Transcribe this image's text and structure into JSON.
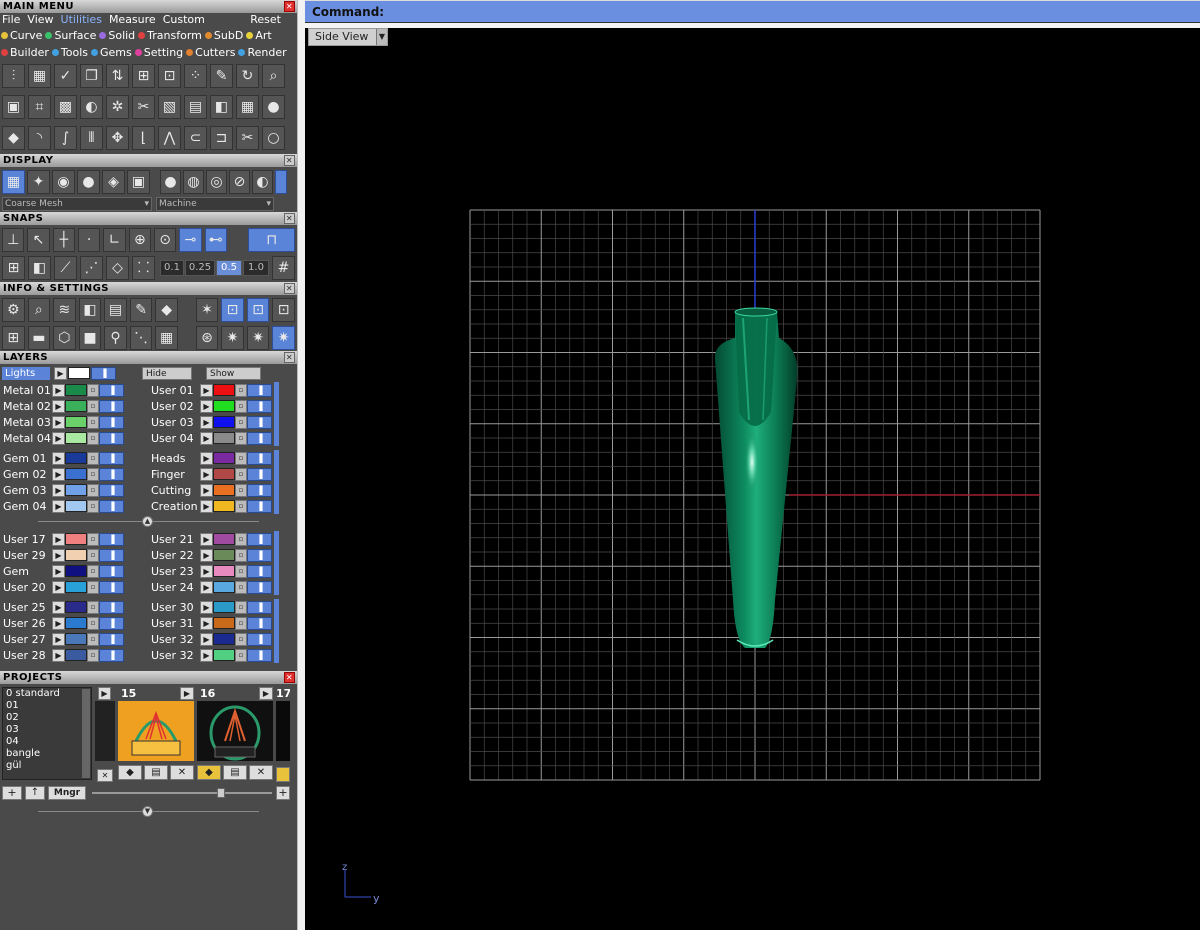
{
  "main_menu": {
    "title": "MAIN MENU",
    "menu": [
      "File",
      "View",
      "Utilities",
      "Measure",
      "Custom"
    ],
    "reset": "Reset",
    "categories_row1": [
      {
        "label": "Curve",
        "color": "#e8c23a"
      },
      {
        "label": "Surface",
        "color": "#3ac26a"
      },
      {
        "label": "Solid",
        "color": "#9a6ae0"
      },
      {
        "label": "Transform",
        "color": "#e04040"
      },
      {
        "label": "SubD",
        "color": "#e08a30"
      },
      {
        "label": "Art",
        "color": "#e8d23a"
      }
    ],
    "categories_row2": [
      {
        "label": "Builder",
        "color": "#e04040"
      },
      {
        "label": "Tools",
        "color": "#40a0e0"
      },
      {
        "label": "Gems",
        "color": "#40a0e0"
      },
      {
        "label": "Setting",
        "color": "#e040a0"
      },
      {
        "label": "Cutters",
        "color": "#e08030"
      },
      {
        "label": "Render",
        "color": "#40a0e0"
      }
    ]
  },
  "display": {
    "title": "DISPLAY",
    "mesh_select": "Coarse Mesh",
    "material_select": "Machine"
  },
  "snaps": {
    "title": "SNAPS",
    "values": [
      "0.1",
      "0.25",
      "0.5",
      "1.0"
    ]
  },
  "info": {
    "title": "INFO & SETTINGS"
  },
  "layers": {
    "title": "LAYERS",
    "lights": "Lights",
    "hide": "Hide",
    "show": "Show",
    "group1_left": [
      {
        "name": "Metal 01",
        "color": "#1a8a4a"
      },
      {
        "name": "Metal 02",
        "color": "#3ab05a"
      },
      {
        "name": "Metal 03",
        "color": "#6ad06a"
      },
      {
        "name": "Metal 04",
        "color": "#a8e8a0"
      }
    ],
    "group1_right": [
      {
        "name": "User 01",
        "color": "#ee1010"
      },
      {
        "name": "User 02",
        "color": "#20dd20"
      },
      {
        "name": "User 03",
        "color": "#1010ee"
      },
      {
        "name": "User 04",
        "color": "#8a8a8a"
      }
    ],
    "group2_left": [
      {
        "name": "Gem 01",
        "color": "#1a3a9a"
      },
      {
        "name": "Gem 02",
        "color": "#3a70d0"
      },
      {
        "name": "Gem 03",
        "color": "#70a0e8"
      },
      {
        "name": "Gem 04",
        "color": "#a0c8f0"
      }
    ],
    "group2_right": [
      {
        "name": "Heads",
        "color": "#7a2aa0"
      },
      {
        "name": "Finger",
        "color": "#b04848"
      },
      {
        "name": "Cutting",
        "color": "#e87020"
      },
      {
        "name": "Creation",
        "color": "#f0b820"
      }
    ],
    "group3_left": [
      {
        "name": "User 17",
        "color": "#f08080"
      },
      {
        "name": "User 29",
        "color": "#f0d0b0"
      },
      {
        "name": "Gem",
        "color": "#101080"
      },
      {
        "name": "User 20",
        "color": "#2aa0d8"
      }
    ],
    "group3_right": [
      {
        "name": "User 21",
        "color": "#a04aa0"
      },
      {
        "name": "User 22",
        "color": "#6a8a5a"
      },
      {
        "name": "User 23",
        "color": "#e88ac0"
      },
      {
        "name": "User 24",
        "color": "#5aa8e0"
      }
    ],
    "group4_left": [
      {
        "name": "User 25",
        "color": "#2a2a8a"
      },
      {
        "name": "User 26",
        "color": "#2a7ad0"
      },
      {
        "name": "User 27",
        "color": "#4a78b8"
      },
      {
        "name": "User 28",
        "color": "#3a5aa0"
      }
    ],
    "group4_right": [
      {
        "name": "User 30",
        "color": "#2a9ac8"
      },
      {
        "name": "User 31",
        "color": "#c86a1a"
      },
      {
        "name": "User 32",
        "color": "#1a2a90"
      },
      {
        "name": "User 32",
        "color": "#50d080"
      }
    ]
  },
  "projects": {
    "title": "PROJECTS",
    "list": [
      "0 standard",
      "01",
      "02",
      "03",
      "04",
      "bangle",
      "gül"
    ],
    "thumb1_num": "15",
    "thumb2_num": "16",
    "thumb3_num": "17",
    "mngr": "Mngr"
  },
  "command": {
    "label": "Command:"
  },
  "viewport": {
    "view_name": "Side View",
    "axis_z": "z",
    "axis_y": "y"
  },
  "colors": {
    "accent": "#5b84d8",
    "model": "#0d7a55",
    "grid": "#6a6a6a"
  }
}
